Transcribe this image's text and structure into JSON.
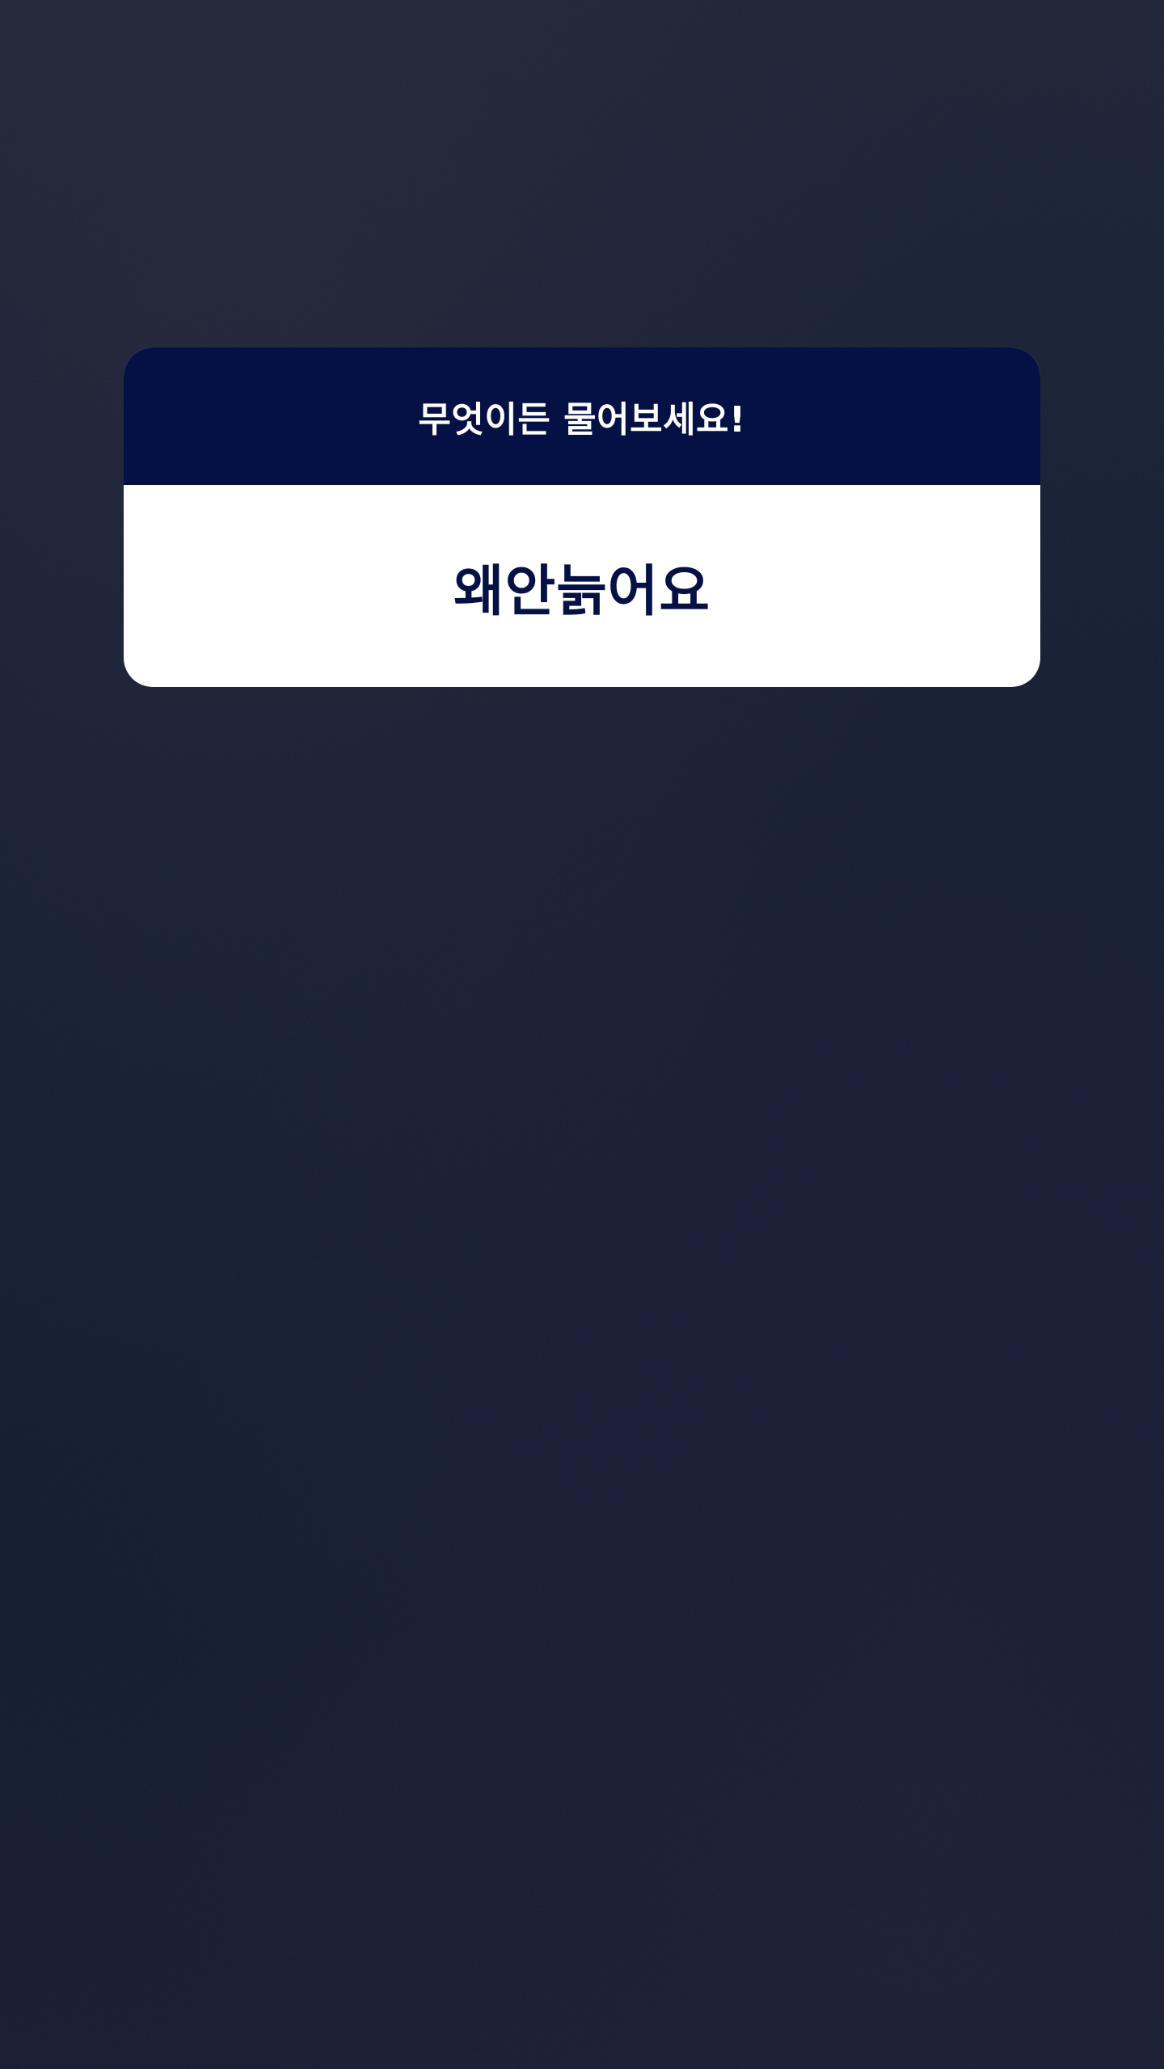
{
  "question_sticker": {
    "prompt": "무엇이든 물어보세요!",
    "answer": "왜안늙어요"
  },
  "colors": {
    "background": "#131b30",
    "header": "#051144",
    "card": "#ffffff",
    "answer_text": "#051144"
  }
}
